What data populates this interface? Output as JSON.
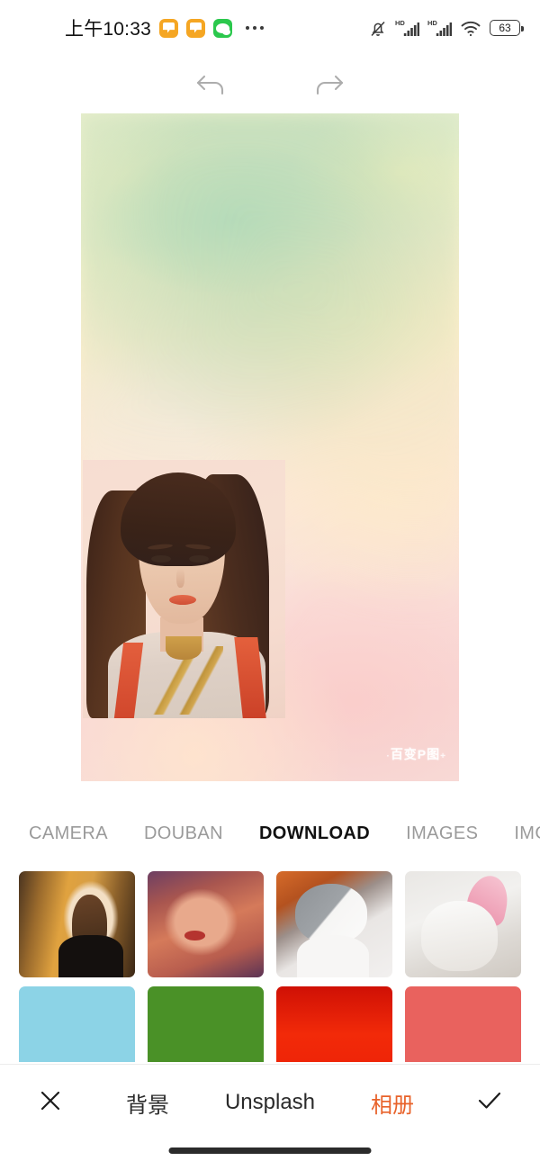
{
  "status_bar": {
    "time": "上午10:33",
    "app_icons": [
      "note-orange-icon",
      "note-orange-icon",
      "wechat-icon"
    ],
    "overflow": "•••",
    "right_icons": [
      "bell-muted-icon",
      "hd-signal-icon",
      "hd-signal-icon",
      "wifi-icon"
    ],
    "hd_label": "HD",
    "battery_level": "63"
  },
  "toolbar": {
    "undo_label": "undo",
    "redo_label": "redo"
  },
  "canvas": {
    "watermark": "百变P图",
    "watermark_prefix": "·",
    "watermark_suffix": "+",
    "background_description": "pastel watercolor gradient",
    "overlay_image": "portrait-photo"
  },
  "tabs": {
    "active": "DOWNLOAD",
    "items": [
      {
        "label": "CAMERA",
        "active": false
      },
      {
        "label": "DOUBAN",
        "active": false
      },
      {
        "label": "DOWNLOAD",
        "active": true
      },
      {
        "label": "IMAGES",
        "active": false
      },
      {
        "label": "IMG_CACHE",
        "active": false
      }
    ]
  },
  "gallery": {
    "rows": [
      [
        {
          "name": "thumb-woman-window",
          "kind": "photo"
        },
        {
          "name": "thumb-woman-laughing",
          "kind": "photo"
        },
        {
          "name": "thumb-cat-gray-white",
          "kind": "photo"
        },
        {
          "name": "thumb-cat-bunny-ears",
          "kind": "photo"
        }
      ],
      [
        {
          "name": "swatch-light-blue",
          "kind": "color",
          "color": "#8CD3E6"
        },
        {
          "name": "swatch-green",
          "kind": "color",
          "color": "#4A9127"
        },
        {
          "name": "swatch-red",
          "kind": "color",
          "color": "#F22A09"
        },
        {
          "name": "swatch-salmon",
          "kind": "color",
          "color": "#E9625E"
        }
      ]
    ]
  },
  "bottom_bar": {
    "close_label": "×",
    "background_label": "背景",
    "unsplash_label": "Unsplash",
    "album_label": "相册",
    "confirm_label": "✓",
    "accent_color": "#E8622A"
  }
}
